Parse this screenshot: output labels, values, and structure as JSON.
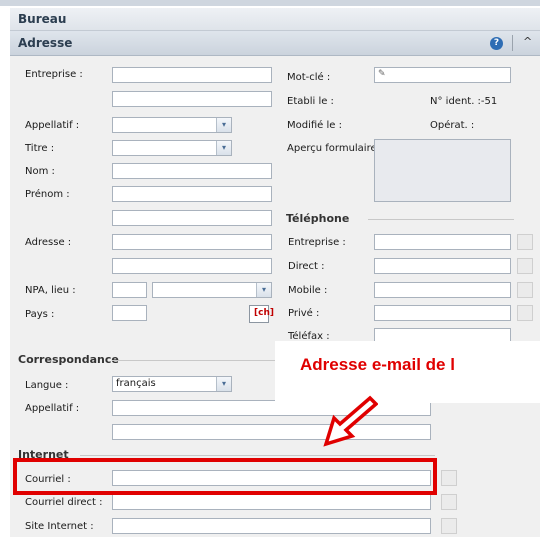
{
  "header": {
    "title": "Bureau"
  },
  "panel": {
    "title": "Adresse",
    "help_glyph": "?",
    "collapse_glyph": "^"
  },
  "form": {
    "entreprise": "Entreprise :",
    "appellatif": "Appellatif :",
    "titre": "Titre :",
    "nom": "Nom :",
    "prenom": "Prénom :",
    "adresse": "Adresse :",
    "npa_lieu": "NPA, lieu :",
    "pays": "Pays :",
    "pays_flag": "[ch]"
  },
  "meta": {
    "mot_cle": "Mot-clé :",
    "etabli_le": "Etabli le :",
    "no_ident": "N° ident. :-51",
    "modifie_le": "Modifié le :",
    "operat": "Opérat. :",
    "apercu": "Aperçu formulaire"
  },
  "telephone": {
    "title": "Téléphone",
    "entreprise": "Entreprise :",
    "direct": "Direct :",
    "mobile": "Mobile :",
    "prive": "Privé :",
    "telefax": "Téléfax :"
  },
  "correspondance": {
    "title": "Correspondance",
    "langue": "Langue :",
    "langue_value": "français",
    "appellatif": "Appellatif :"
  },
  "internet": {
    "title": "Internet",
    "courriel": "Courriel :",
    "courriel_direct": "Courriel direct :",
    "site": "Site Internet :"
  },
  "annotation": {
    "text": "Adresse e-mail de l",
    "color": "#e00000"
  }
}
